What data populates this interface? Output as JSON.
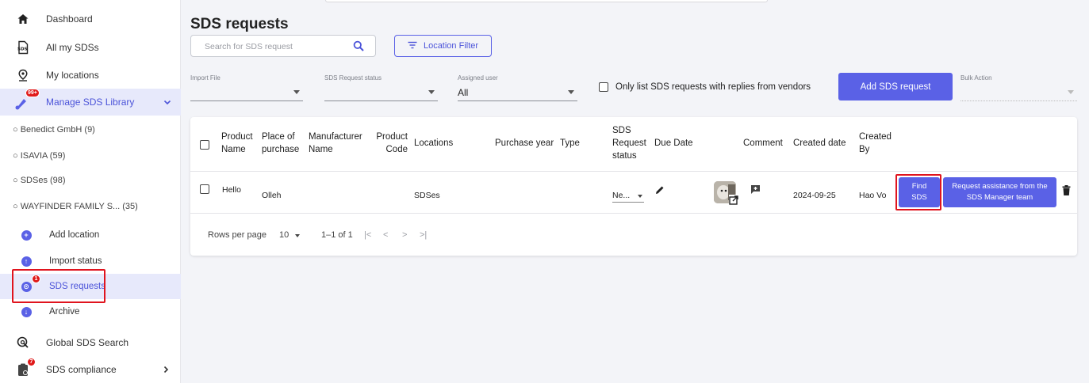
{
  "sidebar": {
    "items": [
      {
        "label": "Dashboard"
      },
      {
        "label": "All my SDSs"
      },
      {
        "label": "My locations"
      },
      {
        "label": "Manage SDS Library",
        "badge": "99+"
      }
    ],
    "libraries": [
      {
        "label": "Benedict GmbH (9)"
      },
      {
        "label": "ISAVIA (59)"
      },
      {
        "label": "SDSes (98)"
      },
      {
        "label": "WAYFINDER FAMILY S... (35)"
      }
    ],
    "children": [
      {
        "label": "Add location"
      },
      {
        "label": "Import status"
      },
      {
        "label": "SDS requests",
        "badge": "1"
      },
      {
        "label": "Archive"
      }
    ],
    "bottom": [
      {
        "label": "Global SDS Search"
      },
      {
        "label": "SDS compliance",
        "badge": "7"
      }
    ]
  },
  "page": {
    "title": "SDS requests",
    "search_placeholder": "Search for SDS request",
    "location_filter": "Location Filter"
  },
  "filters": {
    "import_file_label": "Import File",
    "import_file_value": "",
    "status_label": "SDS Request status",
    "status_value": "",
    "assigned_label": "Assigned user",
    "assigned_value": "All",
    "vendor_checkbox_label": "Only list SDS requests with replies from vendors",
    "add_button": "Add SDS request",
    "bulk_label": "Bulk Action",
    "bulk_value": ""
  },
  "table": {
    "headers": {
      "product": [
        "Product",
        "Name"
      ],
      "place": [
        "Place of",
        "purchase"
      ],
      "manufacturer": [
        "Manufacturer",
        "Name"
      ],
      "code": [
        "Product",
        "Code"
      ],
      "locations": "Locations",
      "year": "Purchase year",
      "type": "Type",
      "status": [
        "SDS",
        "Request",
        "status"
      ],
      "due": "Due Date",
      "comment": "Comment",
      "created_date": "Created date",
      "created_by": [
        "Created",
        "By"
      ]
    },
    "rows": [
      {
        "product": "Hello",
        "place": "Olleh",
        "manufacturer": "",
        "code": "",
        "locations": "SDSes",
        "year": "",
        "type": "",
        "status": "Ne...",
        "created_date": "2024-09-25",
        "created_by": "Hao Vo",
        "find_sds": [
          "Find",
          "SDS"
        ],
        "request_assist": [
          "Request assistance from the",
          "SDS Manager team"
        ]
      }
    ]
  },
  "pagination": {
    "rows_per_page_label": "Rows per page",
    "rows_per_page_value": "10",
    "range": "1–1 of 1",
    "first": "|<",
    "prev": "<",
    "next": ">",
    "last": ">|"
  },
  "colors": {
    "accent": "#5a61e6",
    "active_bg": "#e7e9fb",
    "highlight": "#e0141e",
    "badge": "#e01a1a"
  }
}
